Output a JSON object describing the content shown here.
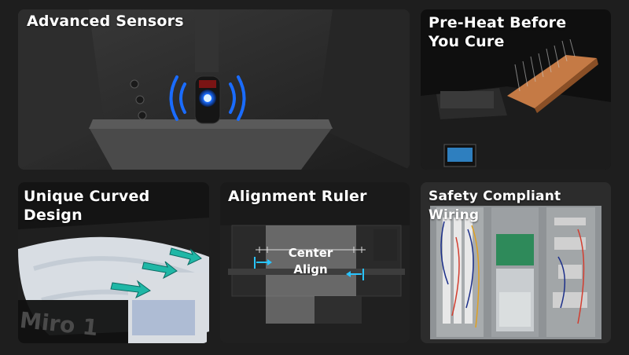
{
  "cards": [
    {
      "id": "sensors",
      "title": "Advanced Sensors"
    },
    {
      "id": "preheat",
      "title": "Pre-Heat Before\nYou Cure"
    },
    {
      "id": "curved",
      "title": "Unique Curved Design"
    },
    {
      "id": "ruler",
      "title": "Alignment Ruler",
      "overlay_text": "Center\nAlign"
    },
    {
      "id": "wiring",
      "title": "Safety Compliant Wiring"
    }
  ],
  "watermark_text": "Miro 1",
  "colors": {
    "background": "#1e1e1e",
    "sensor_glow": "#1a6cff",
    "heat_plate": "#c57a45",
    "arrow_teal": "#1fb7a6",
    "ruler_cyan": "#29c4ff"
  }
}
